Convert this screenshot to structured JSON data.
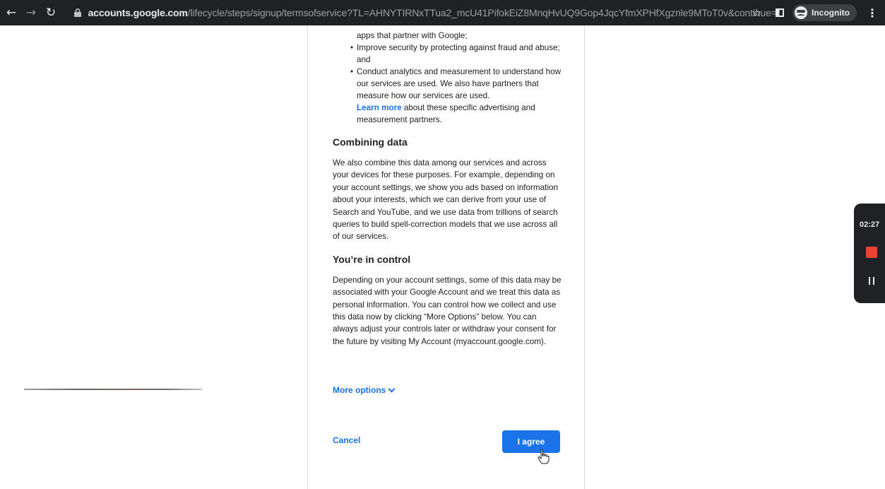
{
  "browser": {
    "url_host": "accounts.google.com",
    "url_path": "/lifecycle/steps/signup/termsofservice?TL=AHNYTIRNxTTua2_mcU41PifokEiZ8MnqHvUQ9Gop4JqcYfmXPHfXgznle9MToT0v&continue=http...",
    "incognito_label": "Incognito",
    "icons": [
      "back-icon",
      "forward-icon",
      "reload-icon",
      "lock-icon",
      "star-icon",
      "side-panel-icon",
      "incognito-icon",
      "kebab-menu-icon"
    ]
  },
  "terms": {
    "bullets": [
      {
        "text": "apps that partner with Google;",
        "bullet": false
      },
      {
        "text": "Improve security by protecting against fraud and abuse; and",
        "bullet": true
      },
      {
        "text": "Conduct analytics and measurement to understand how our services are used. We also have partners that measure how our services are used.",
        "bullet": true
      }
    ],
    "learn_more_link": "Learn more",
    "learn_more_rest": " about these specific advertising and measurement partners.",
    "combining_heading": "Combining data",
    "combining_body": "We also combine this data among our services and across your devices for these purposes. For example, depending on your account settings, we show you ads based on information about your interests, which we can derive from your use of Search and YouTube, and we use data from trillions of search queries to build spell-correction models that we use across all of our services.",
    "control_heading": "You’re in control",
    "control_body": "Depending on your account settings, some of this data may be associated with your Google Account and we treat this data as personal information. You can control how we collect and use this data now by clicking “More Options” below. You can always adjust your controls later or withdraw your consent for the future by visiting My Account (myaccount.google.com).",
    "more_options_label": "More options",
    "cancel_label": "Cancel",
    "agree_label": "I agree"
  },
  "recorder": {
    "time": "02:27",
    "icons": [
      "stop-record-icon",
      "pause-icon"
    ]
  },
  "colors": {
    "link_blue": "#1a73e8",
    "toolbar_bg": "#202124",
    "stop_red": "#ea4335"
  }
}
